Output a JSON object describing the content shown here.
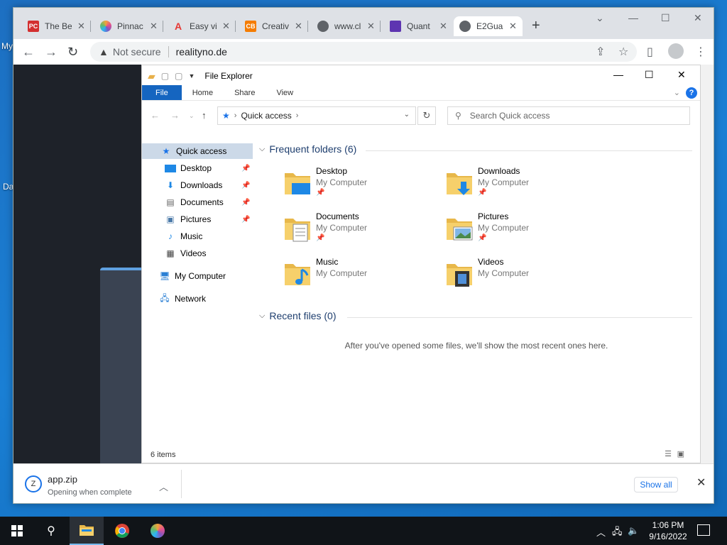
{
  "desktop": {
    "labels": [
      "My",
      "Da"
    ]
  },
  "browser": {
    "tabs": [
      {
        "title": "The Be",
        "favicon_text": "PC",
        "color": "#d32f2f"
      },
      {
        "title": "Pinnac",
        "favicon_text": "",
        "color": "#f2a33a"
      },
      {
        "title": "Easy vi",
        "favicon_text": "A",
        "color": "#e53935"
      },
      {
        "title": "Creativ",
        "favicon_text": "CB",
        "color": "#f57c00"
      },
      {
        "title": "www.cl",
        "favicon_text": "",
        "color": "#5f6368"
      },
      {
        "title": "Quant",
        "favicon_text": "",
        "color": "#5e35b1"
      },
      {
        "title": "E2Gua",
        "favicon_text": "",
        "color": "#5f6368",
        "active": true
      }
    ],
    "security": "Not secure",
    "url": "realityno.de"
  },
  "explorer": {
    "title": "File Explorer",
    "ribbon_tabs": [
      "File",
      "Home",
      "Share",
      "View"
    ],
    "help": "?",
    "address": "Quick access",
    "search_placeholder": "Search Quick access",
    "nav": [
      {
        "label": "Quick access",
        "icon": "star-icon"
      },
      {
        "label": "Desktop",
        "icon": "desktop-icon",
        "pinned": true
      },
      {
        "label": "Downloads",
        "icon": "download-icon",
        "pinned": true
      },
      {
        "label": "Documents",
        "icon": "documents-icon",
        "pinned": true
      },
      {
        "label": "Pictures",
        "icon": "pictures-icon",
        "pinned": true
      },
      {
        "label": "Music",
        "icon": "music-icon"
      },
      {
        "label": "Videos",
        "icon": "videos-icon"
      },
      {
        "label": "My Computer",
        "icon": "computer-icon"
      },
      {
        "label": "Network",
        "icon": "network-icon"
      }
    ],
    "frequent_header": "Frequent folders (6)",
    "folders": [
      {
        "name": "Desktop",
        "location": "My Computer",
        "pinned": true
      },
      {
        "name": "Downloads",
        "location": "My Computer",
        "pinned": true
      },
      {
        "name": "Documents",
        "location": "My Computer",
        "pinned": true
      },
      {
        "name": "Pictures",
        "location": "My Computer",
        "pinned": true
      },
      {
        "name": "Music",
        "location": "My Computer",
        "pinned": false
      },
      {
        "name": "Videos",
        "location": "My Computer",
        "pinned": false
      }
    ],
    "recent_header": "Recent files (0)",
    "recent_message": "After you've opened some files, we'll show the most recent ones here.",
    "status": "6 items"
  },
  "download": {
    "filename": "app.zip",
    "status": "Opening when complete",
    "show_all": "Show all"
  },
  "taskbar": {
    "time": "1:06 PM",
    "date": "9/16/2022"
  }
}
